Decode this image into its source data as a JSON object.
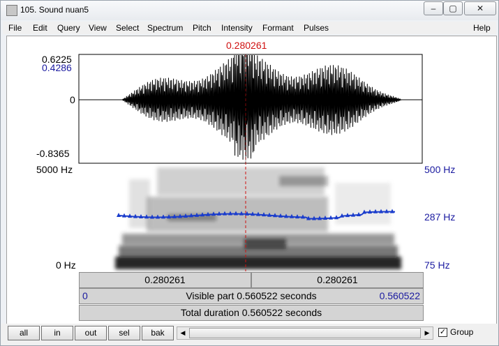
{
  "window": {
    "title": "105. Sound nuan5",
    "min_glyph": "‒",
    "max_glyph": "▢",
    "close_glyph": "✕"
  },
  "menu": [
    "File",
    "Edit",
    "Query",
    "View",
    "Select",
    "Spectrum",
    "Pitch",
    "Intensity",
    "Formant",
    "Pulses",
    "Help"
  ],
  "cursor": {
    "time_label": "0.280261"
  },
  "waveform": {
    "max_label": "0.6225",
    "cursor_value_label": "0.4286",
    "zero_label": "0",
    "min_label": "-0.8365"
  },
  "spectrogram": {
    "top_freq_label": "5000 Hz",
    "bottom_freq_label": "0 Hz",
    "pitch_top_label": "500 Hz",
    "pitch_mid_label": "287 Hz",
    "pitch_bottom_label": "75 Hz"
  },
  "time_panels": {
    "left_segment": "0.280261",
    "right_segment": "0.280261",
    "visible_start": "0",
    "visible_part": "Visible part 0.560522 seconds",
    "visible_end": "0.560522",
    "total_duration": "Total duration 0.560522 seconds"
  },
  "buttons": {
    "all": "all",
    "in": "in",
    "out": "out",
    "sel": "sel",
    "bak": "bak"
  },
  "scroll": {
    "left_glyph": "◀",
    "right_glyph": "▶"
  },
  "group": {
    "label": "Group",
    "checked": true,
    "check_glyph": "✓"
  },
  "colors": {
    "cursor": "#d01010",
    "pitch_line": "#1a3ccc",
    "blue_text": "#1a1aa0"
  }
}
